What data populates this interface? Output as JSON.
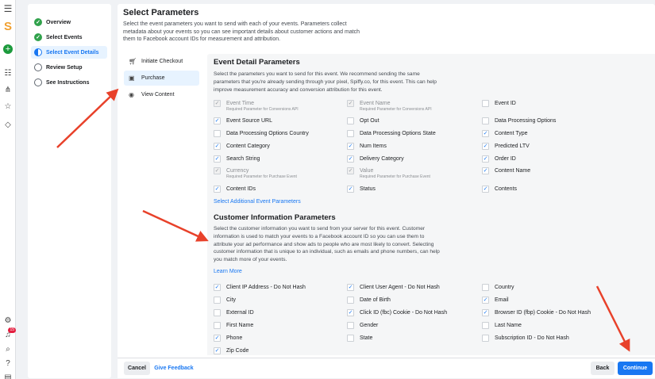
{
  "rail": {
    "icons": [
      "menu-icon",
      "logo-s",
      "add-icon",
      "list-icon",
      "graph-icon",
      "star-icon",
      "gem-icon",
      "gear-icon",
      "bell-icon",
      "search-icon",
      "help-icon",
      "doc-icon"
    ],
    "logo_letter": "S",
    "notification_count": "15"
  },
  "steps": [
    {
      "label": "Overview",
      "status": "done"
    },
    {
      "label": "Select Events",
      "status": "done"
    },
    {
      "label": "Select Event Details",
      "status": "current"
    },
    {
      "label": "Review Setup",
      "status": "todo"
    },
    {
      "label": "See Instructions",
      "status": "todo"
    }
  ],
  "header": {
    "title": "Select Parameters",
    "description": "Select the event parameters you want to send with each of your events. Parameters collect metadata about your events so you can see important details about customer actions and match them to Facebook account IDs for measurement and attribution."
  },
  "events": [
    {
      "label": "Initiate Checkout",
      "icon": "cart-icon",
      "selected": false
    },
    {
      "label": "Purchase",
      "icon": "bag-icon",
      "selected": true
    },
    {
      "label": "View Content",
      "icon": "eye-icon",
      "selected": false
    }
  ],
  "event_params": {
    "title": "Event Detail Parameters",
    "description": "Select the parameters you want to send for this event. We recommend sending the same parameters that you're already sending through your pixel, Spiffy.co, for this event. This can help improve measurement accuracy and conversion attribution for this event.",
    "items": [
      {
        "label": "Event Time",
        "sub": "Required Parameter for Conversions API",
        "checked": true,
        "disabled": true
      },
      {
        "label": "Event Name",
        "sub": "Required Parameter for Conversions API",
        "checked": true,
        "disabled": true
      },
      {
        "label": "Event ID",
        "sub": "",
        "checked": false,
        "disabled": false
      },
      {
        "label": "Event Source URL",
        "sub": "",
        "checked": true,
        "disabled": false
      },
      {
        "label": "Opt Out",
        "sub": "",
        "checked": false,
        "disabled": false
      },
      {
        "label": "Data Processing Options",
        "sub": "",
        "checked": false,
        "disabled": false
      },
      {
        "label": "Data Processing Options Country",
        "sub": "",
        "checked": false,
        "disabled": false
      },
      {
        "label": "Data Processing Options State",
        "sub": "",
        "checked": false,
        "disabled": false
      },
      {
        "label": "Content Type",
        "sub": "",
        "checked": true,
        "disabled": false
      },
      {
        "label": "Content Category",
        "sub": "",
        "checked": true,
        "disabled": false
      },
      {
        "label": "Num Items",
        "sub": "",
        "checked": true,
        "disabled": false
      },
      {
        "label": "Predicted LTV",
        "sub": "",
        "checked": true,
        "disabled": false
      },
      {
        "label": "Search String",
        "sub": "",
        "checked": true,
        "disabled": false
      },
      {
        "label": "Delivery Category",
        "sub": "",
        "checked": true,
        "disabled": false
      },
      {
        "label": "Order ID",
        "sub": "",
        "checked": true,
        "disabled": false
      },
      {
        "label": "Currency",
        "sub": "Required Parameter for Purchase Event",
        "checked": true,
        "disabled": true
      },
      {
        "label": "Value",
        "sub": "Required Parameter for Purchase Event",
        "checked": true,
        "disabled": true
      },
      {
        "label": "Content Name",
        "sub": "",
        "checked": true,
        "disabled": false
      },
      {
        "label": "Content IDs",
        "sub": "",
        "checked": true,
        "disabled": false
      },
      {
        "label": "Status",
        "sub": "",
        "checked": true,
        "disabled": false
      },
      {
        "label": "Contents",
        "sub": "",
        "checked": true,
        "disabled": false
      }
    ],
    "add_link": "Select Additional Event Parameters"
  },
  "customer_params": {
    "title": "Customer Information Parameters",
    "description": "Select the customer information you want to send from your server for this event. Customer information is used to match your events to a Facebook account ID so you can use them to attribute your ad performance and show ads to people who are most likely to convert. Selecting customer information that is unique to an individual, such as emails and phone numbers, can help you match more of your events.",
    "learn_more": "Learn More",
    "items": [
      {
        "label": "Client IP Address - Do Not Hash",
        "checked": true
      },
      {
        "label": "Client User Agent - Do Not Hash",
        "checked": true
      },
      {
        "label": "Country",
        "checked": false
      },
      {
        "label": "City",
        "checked": false
      },
      {
        "label": "Date of Birth",
        "checked": false
      },
      {
        "label": "Email",
        "checked": true
      },
      {
        "label": "External ID",
        "checked": false
      },
      {
        "label": "Click ID (fbc) Cookie - Do Not Hash",
        "checked": true
      },
      {
        "label": "Browser ID (fbp) Cookie - Do Not Hash",
        "checked": true
      },
      {
        "label": "First Name",
        "checked": false
      },
      {
        "label": "Gender",
        "checked": false
      },
      {
        "label": "Last Name",
        "checked": false
      },
      {
        "label": "Phone",
        "checked": true
      },
      {
        "label": "State",
        "checked": false
      },
      {
        "label": "Subscription ID - Do Not Hash",
        "checked": false
      },
      {
        "label": "Zip Code",
        "checked": true
      }
    ]
  },
  "footer": {
    "cancel": "Cancel",
    "feedback": "Give Feedback",
    "back": "Back",
    "continue": "Continue"
  },
  "colors": {
    "accent": "#1877f2",
    "done": "#31a24c",
    "arrow": "#e8412a"
  }
}
